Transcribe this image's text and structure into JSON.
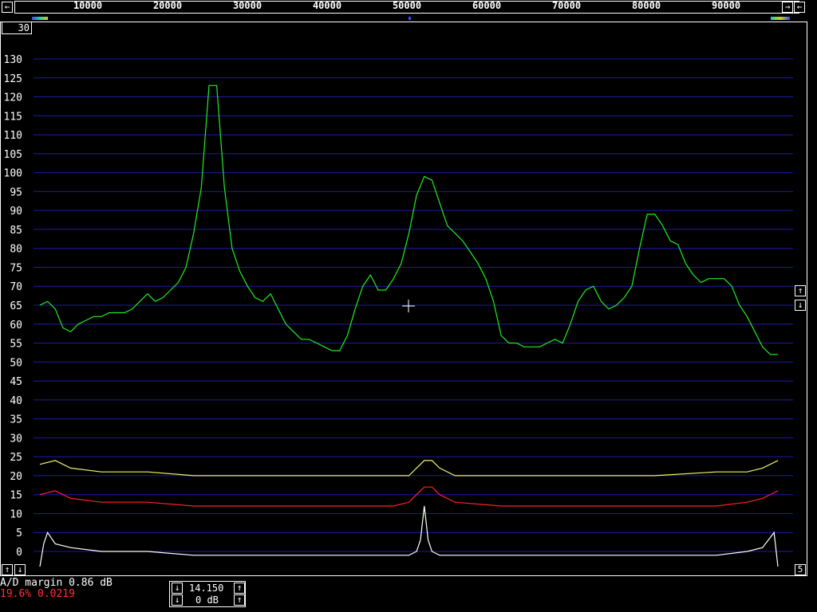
{
  "freq_scale": {
    "tick_labels": [
      "10000",
      "20000",
      "30000",
      "40000",
      "50000",
      "60000",
      "70000",
      "80000",
      "90000"
    ],
    "left_arrow": "←",
    "right_arrow": "→"
  },
  "corner_label": "30",
  "y_axis": {
    "labels": [
      "130",
      "125",
      "120",
      "115",
      "110",
      "105",
      "100",
      "95",
      "90",
      "85",
      "80",
      "75",
      "70",
      "65",
      "60",
      "55",
      "50",
      "45",
      "40",
      "35",
      "30",
      "25",
      "20",
      "15",
      "10",
      "5",
      "0"
    ]
  },
  "side_buttons": {
    "up": "↑",
    "down": "↓",
    "right_bottom": "5"
  },
  "status": {
    "ad_margin": "A/D margin 0.86 dB",
    "error_line": "19.6% 0.0219"
  },
  "controls": {
    "level": "14.150",
    "gain": "0 dB",
    "up": "↑",
    "down": "↓"
  },
  "colors": {
    "grid": "#1c1ca8",
    "green_trace": "#22ee22",
    "yellow_trace": "#f2f266",
    "red_trace": "#ff2222",
    "white_trace": "#ffffff",
    "error_text": "#ff3333"
  },
  "chart_data": {
    "type": "line",
    "x_range": [
      0,
      96000
    ],
    "ylim": [
      0,
      130
    ],
    "grid": true,
    "series": [
      {
        "color": "green",
        "x": [
          0,
          1000,
          2000,
          3000,
          4000,
          5000,
          6000,
          7000,
          8000,
          9000,
          10000,
          11000,
          12000,
          13000,
          14000,
          15000,
          16000,
          17000,
          18000,
          19000,
          20000,
          21000,
          22000,
          23000,
          24000,
          25000,
          26000,
          27000,
          28000,
          29000,
          30000,
          31000,
          32000,
          33000,
          34000,
          35000,
          36000,
          37000,
          38000,
          39000,
          40000,
          41000,
          42000,
          43000,
          44000,
          45000,
          46000,
          47000,
          48000,
          49000,
          50000,
          51000,
          52000,
          53000,
          54000,
          55000,
          56000,
          57000,
          58000,
          59000,
          60000,
          61000,
          62000,
          63000,
          64000,
          65000,
          66000,
          67000,
          68000,
          69000,
          70000,
          71000,
          72000,
          73000,
          74000,
          75000,
          76000,
          77000,
          78000,
          79000,
          80000,
          81000,
          82000,
          83000,
          84000,
          85000,
          86000,
          87000,
          88000,
          89000,
          90000,
          91000,
          92000,
          93000,
          94000,
          95000,
          96000
        ],
        "y": [
          65,
          66,
          64,
          59,
          58,
          60,
          61,
          62,
          62,
          63,
          63,
          63,
          64,
          66,
          68,
          66,
          67,
          69,
          71,
          75,
          84,
          96,
          123,
          123,
          96,
          80,
          74,
          70,
          67,
          66,
          68,
          64,
          60,
          58,
          56,
          56,
          55,
          54,
          53,
          53,
          57,
          64,
          70,
          73,
          69,
          69,
          72,
          76,
          84,
          94,
          99,
          98,
          92,
          86,
          84,
          82,
          79,
          76,
          72,
          66,
          57,
          55,
          55,
          54,
          54,
          54,
          55,
          56,
          55,
          60,
          66,
          69,
          70,
          66,
          64,
          65,
          67,
          70,
          80,
          89,
          89,
          86,
          82,
          81,
          76,
          73,
          71,
          72,
          72,
          72,
          70,
          65,
          62,
          58,
          54,
          52,
          52
        ]
      },
      {
        "color": "yellow",
        "x": [
          0,
          2000,
          4000,
          8000,
          14000,
          20000,
          30000,
          40000,
          46000,
          48000,
          49000,
          50000,
          51000,
          52000,
          54000,
          60000,
          70000,
          80000,
          88000,
          92000,
          94000,
          96000
        ],
        "y": [
          23,
          24,
          22,
          21,
          21,
          20,
          20,
          20,
          20,
          20,
          22,
          24,
          24,
          22,
          20,
          20,
          20,
          20,
          21,
          21,
          22,
          24
        ]
      },
      {
        "color": "red",
        "x": [
          0,
          2000,
          4000,
          8000,
          14000,
          20000,
          30000,
          40000,
          46000,
          48000,
          49000,
          50000,
          51000,
          52000,
          54000,
          60000,
          70000,
          80000,
          88000,
          92000,
          94000,
          96000
        ],
        "y": [
          15,
          16,
          14,
          13,
          13,
          12,
          12,
          12,
          12,
          13,
          15,
          17,
          17,
          15,
          13,
          12,
          12,
          12,
          12,
          13,
          14,
          16
        ]
      },
      {
        "color": "white",
        "x": [
          0,
          500,
          1000,
          2000,
          4000,
          8000,
          14000,
          20000,
          30000,
          40000,
          46000,
          48000,
          49000,
          49500,
          50000,
          50500,
          51000,
          52000,
          54000,
          60000,
          70000,
          80000,
          88000,
          92000,
          94000,
          95500,
          96000
        ],
        "y": [
          -4,
          2,
          5,
          2,
          1,
          0,
          0,
          -1,
          -1,
          -1,
          -1,
          -1,
          0,
          3,
          12,
          3,
          0,
          -1,
          -1,
          -1,
          -1,
          -1,
          -1,
          0,
          1,
          5,
          -4
        ]
      }
    ]
  }
}
